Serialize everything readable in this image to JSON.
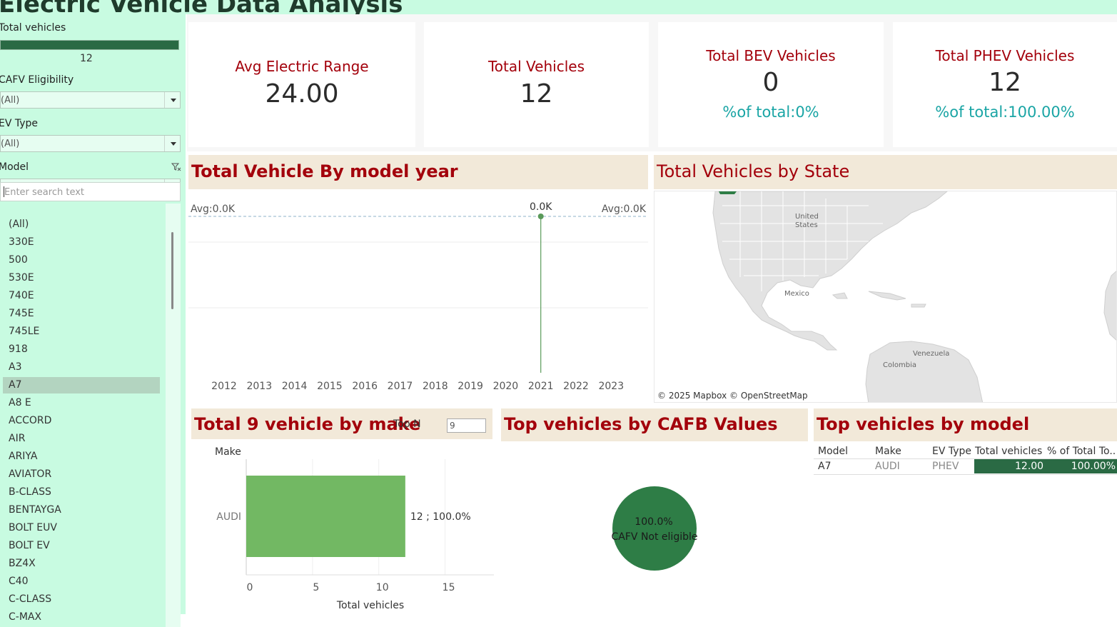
{
  "title": "Electric Vehicle Data Analysis",
  "sidebar": {
    "total_vehicles_label": "Total vehicles",
    "total_vehicles_value": "12",
    "cafv_label": "CAFV Eligibility",
    "cafv_value": "(All)",
    "ev_type_label": "EV Type",
    "ev_type_value": "(All)",
    "model_label": "Model",
    "model_value": "A7",
    "search_placeholder": "Enter search text",
    "model_list": [
      "(All)",
      "330E",
      "500",
      "530E",
      "740E",
      "745E",
      "745LE",
      "918",
      "A3",
      "A7",
      "A8 E",
      "ACCORD",
      "AIR",
      "ARIYA",
      "AVIATOR",
      "B-CLASS",
      "BENTAYGA",
      "BOLT EUV",
      "BOLT EV",
      "BZ4X",
      "C40",
      "C-CLASS",
      "C-MAX"
    ],
    "selected_model": "A7"
  },
  "kpis": {
    "avg_range": {
      "title": "Avg Electric Range",
      "value": "24.00"
    },
    "total": {
      "title": "Total Vehicles",
      "value": "12"
    },
    "bev": {
      "title": "Total BEV Vehicles",
      "value": "0",
      "pct": "%of total:0%"
    },
    "phev": {
      "title": "Total PHEV Vehicles",
      "value": "12",
      "pct": "%of total:100.00%"
    }
  },
  "model_year_panel": {
    "title": "Total Vehicle By model year",
    "avg_left": "Avg:0.0K",
    "avg_right": "Avg:0.0K",
    "point_label": "0.0K"
  },
  "state_panel": {
    "title": "Total Vehicles by State",
    "map_labels": {
      "us": "United States",
      "mexico": "Mexico",
      "venezuela": "Venezuela",
      "colombia": "Colombia"
    },
    "credit": "© 2025 Mapbox © OpenStreetMap"
  },
  "make_panel": {
    "title": "Total 9 vehicle by make",
    "topn_label": "Top N",
    "topn_value": "9",
    "col_header": "Make",
    "bar_label": "12 ; 100.0%",
    "xlabel": "Total vehicles"
  },
  "cafb_panel": {
    "title": "Top vehicles by  CAFB Values",
    "pie_pct": "100.0%",
    "pie_label": "CAFV Not eligible"
  },
  "model_panel": {
    "title": "Top vehicles by model",
    "headers": [
      "Model",
      "Make",
      "EV Type",
      "Total vehicles",
      "% of Total To.."
    ],
    "row": {
      "model": "A7",
      "make": "AUDI",
      "ev_type": "PHEV",
      "total": "12.00",
      "pct": "100.00%"
    }
  },
  "chart_data": [
    {
      "type": "line",
      "title": "Total Vehicle By model year",
      "x": [
        "2012",
        "2013",
        "2014",
        "2015",
        "2016",
        "2017",
        "2018",
        "2019",
        "2020",
        "2021",
        "2022",
        "2023"
      ],
      "series": [
        {
          "values": [
            null,
            null,
            null,
            null,
            null,
            null,
            null,
            null,
            null,
            12,
            null,
            null
          ]
        }
      ],
      "reference_line": "Avg:0.0K",
      "data_label": "0.0K"
    },
    {
      "type": "bar",
      "title": "Total 9 vehicle by make",
      "categories": [
        "AUDI"
      ],
      "values": [
        12
      ],
      "xlabel": "Total vehicles",
      "ylabel": "Make",
      "xlim": [
        0,
        17.5
      ],
      "xticks": [
        "0",
        "5",
        "10",
        "15"
      ],
      "data_label": "12 ; 100.0%",
      "color": "#72b863"
    },
    {
      "type": "pie",
      "title": "Top vehicles by  CAFB Values",
      "categories": [
        "CAFV Not eligible"
      ],
      "values": [
        100.0
      ],
      "color": "#2e7d46"
    }
  ],
  "colors": {
    "accent_red": "#a3000b",
    "teal": "#1aa5a5",
    "mint_bg": "#c8fbe1",
    "dark_green": "#2a6a44",
    "panel_header_bg": "#f2e9d9"
  }
}
